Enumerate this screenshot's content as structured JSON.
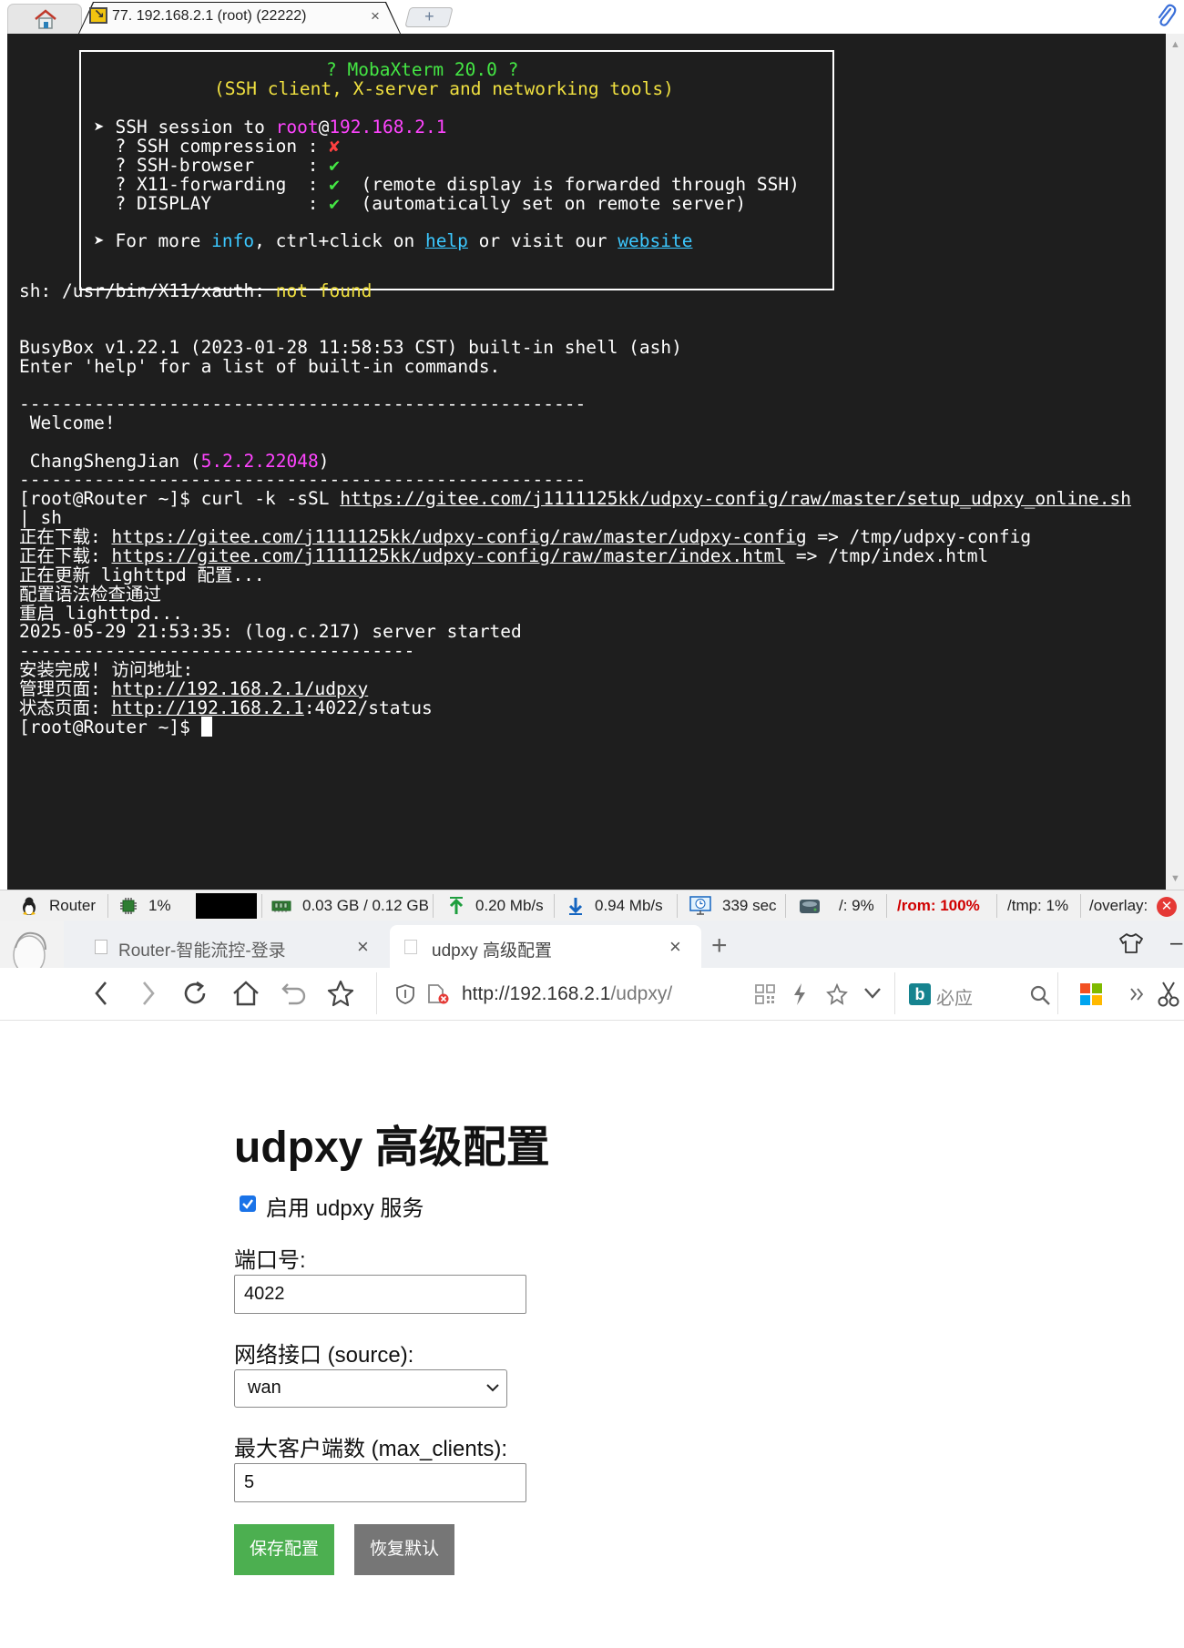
{
  "mobaxterm": {
    "session_tab": "77. 192.168.2.1 (root) (22222)",
    "session_close": "×",
    "new_tab": "+",
    "banner": {
      "title": "? MobaXterm 20.0 ?",
      "subtitle": "(SSH client, X-server and networking tools)",
      "session_prefix": "➤ SSH session to ",
      "session_user": "root",
      "session_at": "@",
      "session_host": "192.168.2.1",
      "rows": [
        {
          "label": "  ? SSH compression : ",
          "mark": "✘",
          "note": ""
        },
        {
          "label": "  ? SSH-browser     : ",
          "mark": "✔",
          "note": ""
        },
        {
          "label": "  ? X11-forwarding  : ",
          "mark": "✔",
          "note": "  (remote display is forwarded through SSH)"
        },
        {
          "label": "  ? DISPLAY         : ",
          "mark": "✔",
          "note": "  (automatically set on remote server)"
        }
      ],
      "info_prefix": "➤ For more ",
      "info_word": "info",
      "info_mid": ", ctrl+click on ",
      "help_word": "help",
      "info_mid2": " or visit our ",
      "website_word": "website"
    },
    "terminal": {
      "xauth_prefix": "sh: /usr/bin/X11/xauth: ",
      "xauth_error": "not found",
      "busybox": "BusyBox v1.22.1 (2023-01-28 11:58:53 CST) built-in shell (ash)",
      "help_hint": "Enter 'help' for a list of built-in commands.",
      "separator": "-----------------------------------------------------",
      "welcome": " Welcome!",
      "firmware_name": " ChangShengJian (",
      "firmware_version": "5.2.2.22048",
      "firmware_close": ")",
      "prompt": "[root@Router ~]$ ",
      "cmd_prefix": "curl -k -sSL ",
      "cmd_url": "https://gitee.com/j1111125kk/udpxy-config/raw/master/setup_udpxy_online.sh",
      "cmd_cont": "| sh",
      "dl1_prefix": "正在下载: ",
      "dl1_url": "https://gitee.com/j1111125kk/udpxy-config/raw/master/udpxy-config",
      "dl1_suffix": " => /tmp/udpxy-config",
      "dl2_prefix": "正在下载: ",
      "dl2_url": "https://gitee.com/j1111125kk/udpxy-config/raw/master/index.html",
      "dl2_suffix": " => /tmp/index.html",
      "update_line": "正在更新 lighttpd 配置...",
      "check_line": "配置语法检查通过",
      "restart_line": "重启 lighttpd...",
      "started_line": "2025-05-29 21:53:35: (log.c.217) server started",
      "separator2": "-------------------------------------",
      "done_line": "安装完成! 访问地址:",
      "admin_prefix": "管理页面: ",
      "admin_url": "http://192.168.2.1/udpxy",
      "status_prefix": "状态页面: ",
      "status_url": "http://192.168.2.1",
      "status_suffix": ":4022/status",
      "final_prompt": "[root@Router ~]$ "
    },
    "statusbar": {
      "host": "Router",
      "cpu": "1%",
      "memory": "0.03 GB / 0.12 GB",
      "upload": "0.20 Mb/s",
      "download": "0.94 Mb/s",
      "uptime": "339 sec",
      "root_fs": "/: 9%",
      "rom_fs": "/rom: 100%",
      "tmp_fs": "/tmp: 1%",
      "overlay_fs": "/overlay:",
      "rom_color": "#d00000"
    }
  },
  "browser": {
    "tabs": [
      {
        "label": "Router-智能流控-登录",
        "close": "×"
      },
      {
        "label": "udpxy 高级配置",
        "close": "×"
      }
    ],
    "new_tab": "+",
    "url_host": "http://192.168.2.1",
    "url_path": "/udpxy/",
    "search_label": "必应",
    "bing_letter": "b"
  },
  "page": {
    "title": "udpxy 高级配置",
    "enable_label": "启用 udpxy 服务",
    "enable_checked": true,
    "port_label": "端口号:",
    "port_value": "4022",
    "iface_label": "网络接口 (source):",
    "iface_value": "wan",
    "max_clients_label": "最大客户端数 (max_clients):",
    "max_clients_value": "5",
    "save_label": "保存配置",
    "reset_label": "恢复默认",
    "save_color": "#4caf50",
    "reset_color": "#767676"
  }
}
